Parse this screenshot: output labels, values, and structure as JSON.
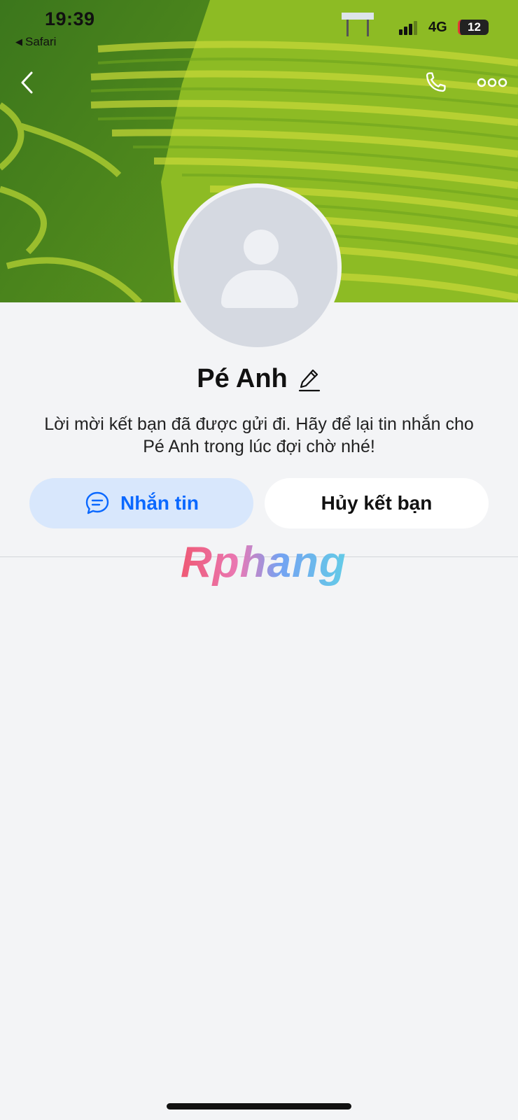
{
  "status_bar": {
    "time": "19:39",
    "back_app": "Safari",
    "back_arrow_icon": "left-triangle-icon",
    "network": "4G",
    "battery": "12"
  },
  "header": {
    "back_icon": "chevron-left-icon",
    "call_icon": "phone-icon",
    "more_icon": "more-dots-icon"
  },
  "profile": {
    "name": "Pé Anh",
    "edit_icon": "pencil-icon",
    "avatar_icon": "default-user-avatar-icon",
    "message": "Lời mời kết bạn đã được gửi đi. Hãy để lại tin nhắn cho Pé Anh trong lúc đợi chờ nhé!"
  },
  "actions": {
    "message_label": "Nhắn tin",
    "message_icon": "chat-bubble-icon",
    "cancel_label": "Hủy kết bạn"
  },
  "watermark": "Rphang",
  "colors": {
    "accent": "#0a68ff",
    "message_button_bg": "#d8e7fc",
    "page_bg": "#f3f4f6"
  }
}
